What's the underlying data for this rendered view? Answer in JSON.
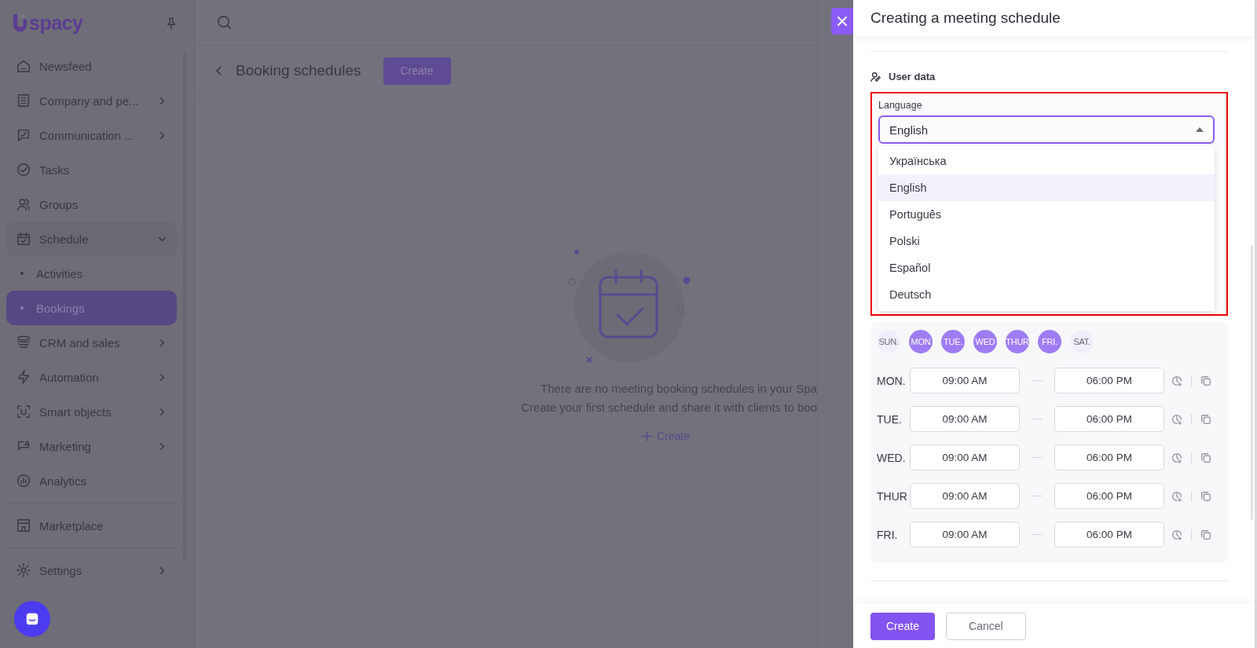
{
  "sidebar": {
    "logo": "spacy",
    "items": [
      {
        "label": "Newsfeed",
        "kind": "link"
      },
      {
        "label": "Company and pe...",
        "kind": "group",
        "expanded": false
      },
      {
        "label": "Communication ...",
        "kind": "group",
        "expanded": false
      },
      {
        "label": "Tasks",
        "kind": "link"
      },
      {
        "label": "Groups",
        "kind": "link"
      },
      {
        "label": "Schedule",
        "kind": "group",
        "expanded": true,
        "children": [
          {
            "label": "Activities",
            "selected": false
          },
          {
            "label": "Bookings",
            "selected": true
          }
        ]
      },
      {
        "label": "CRM and sales",
        "kind": "group",
        "expanded": false
      },
      {
        "label": "Automation",
        "kind": "group",
        "expanded": false
      },
      {
        "label": "Smart objects",
        "kind": "group",
        "expanded": false
      },
      {
        "label": "Marketing",
        "kind": "group",
        "expanded": false
      },
      {
        "label": "Analytics",
        "kind": "link"
      },
      {
        "label": "Marketplace",
        "kind": "link"
      },
      {
        "label": "Settings",
        "kind": "group",
        "expanded": false
      }
    ]
  },
  "page": {
    "title": "Booking schedules",
    "create_button": "Create",
    "empty_lines": [
      "There are no meeting booking schedules in your Spa",
      "Create your first schedule and share it with clients to boo"
    ],
    "empty_create_link": "Create"
  },
  "panel": {
    "title": "Creating a meeting schedule",
    "section": "User data",
    "language": {
      "label": "Language",
      "value": "English",
      "options": [
        {
          "label": "Українська",
          "selected": false
        },
        {
          "label": "English",
          "selected": true
        },
        {
          "label": "Português",
          "selected": false
        },
        {
          "label": "Polski",
          "selected": false
        },
        {
          "label": "Español",
          "selected": false
        },
        {
          "label": "Deutsch",
          "selected": false
        }
      ]
    },
    "days": [
      {
        "label": "SUN.",
        "on": false
      },
      {
        "label": "MON",
        "on": true
      },
      {
        "label": "TUE.",
        "on": true
      },
      {
        "label": "WED",
        "on": true
      },
      {
        "label": "THUR",
        "on": true
      },
      {
        "label": "FRI.",
        "on": true
      },
      {
        "label": "SAT.",
        "on": false
      }
    ],
    "hours": [
      {
        "day": "MON.",
        "start": "09:00 AM",
        "end": "06:00 PM"
      },
      {
        "day": "TUE.",
        "start": "09:00 AM",
        "end": "06:00 PM"
      },
      {
        "day": "WED.",
        "start": "09:00 AM",
        "end": "06:00 PM"
      },
      {
        "day": "THUR",
        "start": "09:00 AM",
        "end": "06:00 PM"
      },
      {
        "day": "FRI.",
        "start": "09:00 AM",
        "end": "06:00 PM"
      }
    ],
    "buttons": [
      {
        "label": "Create",
        "kind": "primary"
      },
      {
        "label": "Cancel",
        "kind": "secondary"
      }
    ]
  }
}
